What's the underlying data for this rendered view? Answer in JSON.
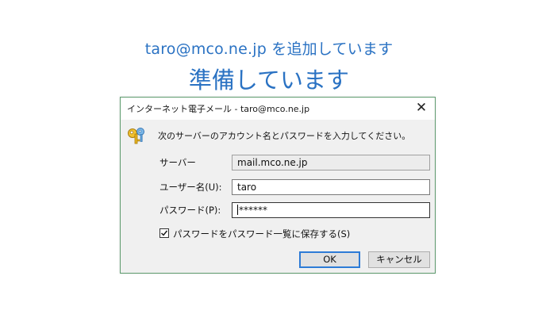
{
  "header": {
    "adding_text": "taro@mco.ne.jp を追加しています",
    "preparing_text": "準備しています"
  },
  "dialog": {
    "title": "インターネット電子メール - taro@mco.ne.jp",
    "close_glyph": "✕",
    "icon": "key-icon",
    "instruction": "次のサーバーのアカウント名とパスワードを入力してください。",
    "server": {
      "label": "サーバー",
      "value": "mail.mco.ne.jp"
    },
    "username": {
      "label": "ユーザー名(U):",
      "value": "taro"
    },
    "password": {
      "label": "パスワード(P):",
      "value": "******"
    },
    "save_password": {
      "label": "パスワードをパスワード一覧に保存する(S)",
      "checked": true
    },
    "buttons": {
      "ok": "OK",
      "cancel": "キャンセル"
    }
  },
  "colors": {
    "accent_text": "#2a72c3",
    "dialog_border": "#5e9b6e",
    "default_button_border": "#2d7bd6"
  }
}
